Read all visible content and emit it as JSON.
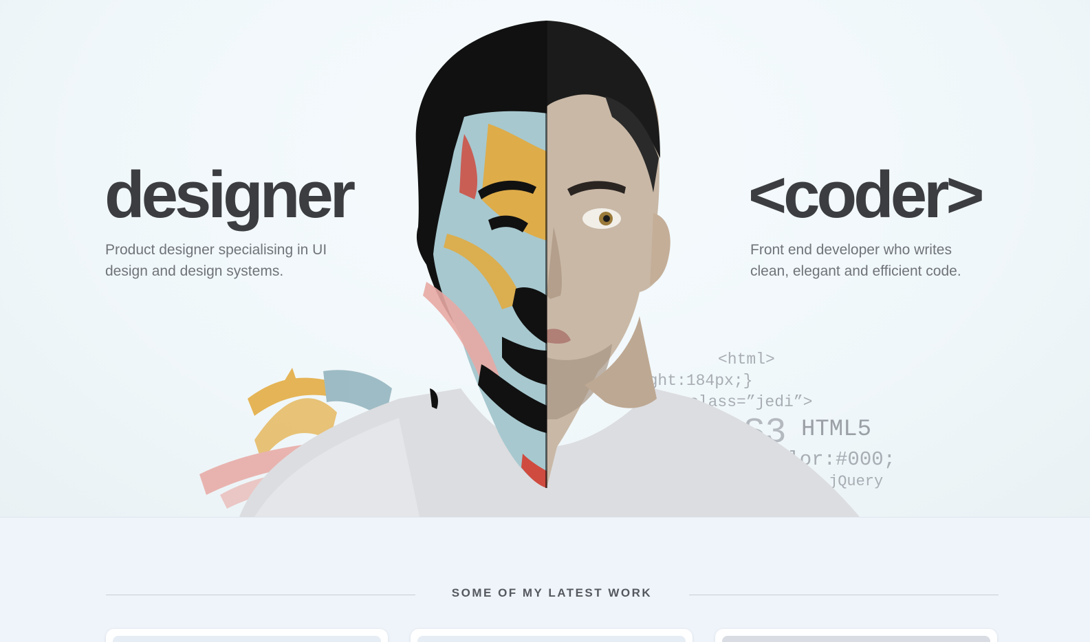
{
  "hero": {
    "left_title": "designer",
    "left_description": "Product designer specialising in UI design and design systems.",
    "right_title": "<coder>",
    "right_description": "Front end developer who writes clean, elegant and efficient code.",
    "code_snippets": [
      "<html>",
      "eight:184px;}",
      "class=”jedi”>",
      "SS3",
      "HTML5",
      "olor:#000;",
      "jQuery"
    ]
  },
  "section": {
    "title": "SOME OF MY LATEST WORK"
  },
  "colors": {
    "heading": "#3c3d40",
    "body_text": "#6f737a",
    "background": "#f3f8fb",
    "paint_teal": "#8fb1bb",
    "paint_orange": "#e4a93a",
    "paint_red": "#cf4b3f",
    "paint_pink": "#e8a8a3"
  },
  "work_cards": [
    {
      "id": "card-1"
    },
    {
      "id": "card-2"
    },
    {
      "id": "card-3"
    }
  ]
}
